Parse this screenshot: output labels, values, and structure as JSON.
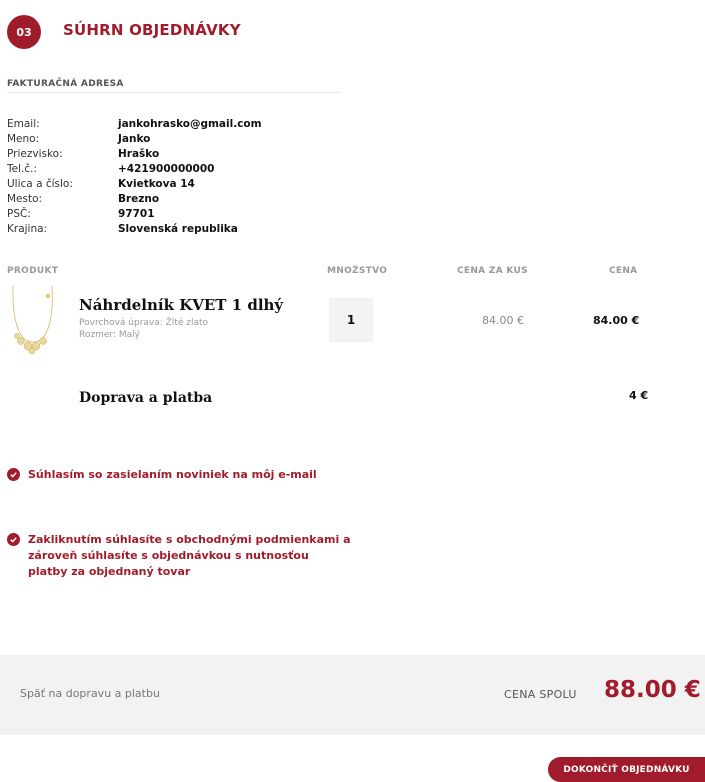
{
  "step": {
    "number": "03",
    "title": "SÚHRN OBJEDNÁVKY"
  },
  "billing": {
    "section_label": "FAKTURAČNÁ ADRESA",
    "rows": [
      {
        "label": "Email:",
        "value": "jankohrasko@gmail.com"
      },
      {
        "label": "Meno:",
        "value": "Janko"
      },
      {
        "label": "Priezvisko:",
        "value": "Hraško"
      },
      {
        "label": "Tel.č.:",
        "value": "+421900000000"
      },
      {
        "label": "Ulica a číslo:",
        "value": "Kvietkova 14"
      },
      {
        "label": "Mesto:",
        "value": "Brezno"
      },
      {
        "label": "PSČ:",
        "value": "97701"
      },
      {
        "label": "Krajina:",
        "value": "Slovenská republika"
      }
    ]
  },
  "table": {
    "headers": {
      "product": "PRODUKT",
      "quantity": "MNOŽSTVO",
      "unit_price": "CENA ZA KUS",
      "price": "CENA"
    }
  },
  "product": {
    "name": "Náhrdelník KVET 1 dlhý",
    "option1": "Povrchová úprava: Žlté zlato",
    "option2": "Rozmer: Malý",
    "quantity": "1",
    "unit_price": "84.00 €",
    "line_price": "84.00 €"
  },
  "shipping": {
    "label": "Doprava a platba",
    "price": "4 €"
  },
  "consents": {
    "newsletter": "Súhlasím so zasielaním noviniek na môj e-mail",
    "terms": "Zakliknutím súhlasíte s obchodnými podmienkami a zároveň súhlasíte s objednávkou s nutnosťou platby za objednaný tovar"
  },
  "footer": {
    "back_link": "Späť na dopravu a platbu",
    "total_label": "CENA SPOLU",
    "total_value": "88.00 €",
    "finish_button": "DOKONČIŤ OBJEDNÁVKU"
  },
  "colors": {
    "accent": "#a01c2d",
    "footer_bg": "#f2f2f2",
    "qty_bg": "#f3f3f3"
  },
  "icons": {
    "check": "check-circle-icon",
    "product_image": "necklace-image"
  }
}
